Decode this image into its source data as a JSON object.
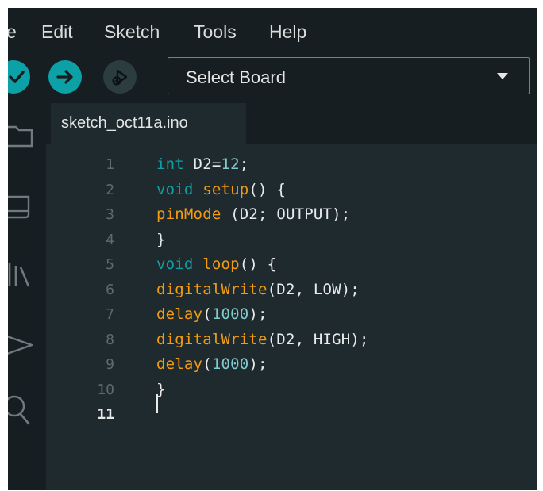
{
  "menu": {
    "items": [
      "e",
      "Edit",
      "Sketch",
      "Tools",
      "Help"
    ]
  },
  "toolbar": {
    "board_select_label": "Select Board"
  },
  "tabs": [
    {
      "label": "sketch_oct11a.ino"
    }
  ],
  "editor": {
    "line_numbers": [
      "1",
      "2",
      "3",
      "4",
      "5",
      "6",
      "7",
      "8",
      "9",
      "10",
      "11"
    ],
    "active_line": "11",
    "lines": [
      [
        {
          "t": "int",
          "k": "type"
        },
        {
          "t": " D2=",
          "k": "plain"
        },
        {
          "t": "12",
          "k": "num"
        },
        {
          "t": ";",
          "k": "plain"
        }
      ],
      [
        {
          "t": "void",
          "k": "type"
        },
        {
          "t": " ",
          "k": "plain"
        },
        {
          "t": "setup",
          "k": "fn"
        },
        {
          "t": "() {",
          "k": "plain"
        }
      ],
      [
        {
          "t": "pinMode",
          "k": "fn"
        },
        {
          "t": " (D2; OUTPUT);",
          "k": "plain"
        }
      ],
      [
        {
          "t": "}",
          "k": "plain"
        }
      ],
      [
        {
          "t": "void",
          "k": "type"
        },
        {
          "t": " ",
          "k": "plain"
        },
        {
          "t": "loop",
          "k": "fn"
        },
        {
          "t": "() {",
          "k": "plain"
        }
      ],
      [
        {
          "t": "digitalWrite",
          "k": "fn"
        },
        {
          "t": "(D2, LOW);",
          "k": "plain"
        }
      ],
      [
        {
          "t": "delay",
          "k": "fn"
        },
        {
          "t": "(",
          "k": "plain"
        },
        {
          "t": "1000",
          "k": "num"
        },
        {
          "t": ");",
          "k": "plain"
        }
      ],
      [
        {
          "t": "digitalWrite",
          "k": "fn"
        },
        {
          "t": "(D2, HIGH);",
          "k": "plain"
        }
      ],
      [
        {
          "t": "delay",
          "k": "fn"
        },
        {
          "t": "(",
          "k": "plain"
        },
        {
          "t": "1000",
          "k": "num"
        },
        {
          "t": ");",
          "k": "plain"
        }
      ],
      [
        {
          "t": "}",
          "k": "plain"
        }
      ],
      []
    ]
  },
  "icons": {
    "verify": "checkmark-icon",
    "upload": "arrow-right-icon",
    "debug": "debug-icon",
    "board_dropdown": "caret-down-icon",
    "sidebar": [
      "folder-icon",
      "board-manager-icon",
      "library-icon",
      "debug-icon",
      "search-icon"
    ]
  },
  "colors": {
    "window_bg": "#171e21",
    "editor_bg": "#1f2a2e",
    "accent_teal": "#0ca1a6",
    "keyword_orange": "#f39c12",
    "number_teal": "#7fcbcd",
    "text": "#e8ebea"
  }
}
